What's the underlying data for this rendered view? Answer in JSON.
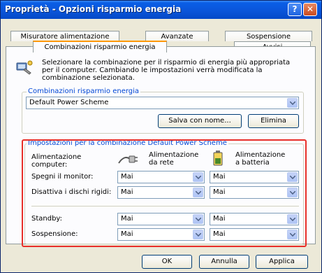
{
  "window": {
    "title": "Proprietà - Opzioni risparmio energia",
    "help_button": "?",
    "close_button": "✕"
  },
  "tabs": {
    "row1": [
      "Misuratore alimentazione",
      "Avanzate",
      "Sospensione"
    ],
    "row2": [
      "Combinazioni risparmio energia",
      "Avvisi"
    ],
    "active": "Combinazioni risparmio energia"
  },
  "intro": {
    "text": "Selezionare la combinazione per il risparmio di energia più appropriata per il computer. Cambiando le impostazioni verrà modificata la combinazione selezionata."
  },
  "schemes": {
    "group_title": "Combinazioni risparmio energia",
    "selected": "Default Power Scheme",
    "save_as": "Salva con nome...",
    "delete": "Elimina"
  },
  "settings": {
    "group_title": "Impostazioni per la combinazione Default Power Scheme",
    "computer_power_label": "Alimentazione computer:",
    "ac_label": "Alimentazione da rete",
    "battery_label": "Alimentazione a batteria",
    "rows": [
      {
        "label": "Spegni il monitor:",
        "ac": "Mai",
        "dc": "Mai"
      },
      {
        "label": "Disattiva i dischi rigidi:",
        "ac": "Mai",
        "dc": "Mai"
      },
      {
        "label": "Standby:",
        "ac": "Mai",
        "dc": "Mai"
      },
      {
        "label": "Sospensione:",
        "ac": "Mai",
        "dc": "Mai"
      }
    ]
  },
  "footer": {
    "ok": "OK",
    "cancel": "Annulla",
    "apply": "Applica"
  },
  "colors": {
    "title_bar": "#0a54d8",
    "group_title": "#0046d5",
    "highlight": "#e8302a",
    "active_tab": "#ff9900"
  }
}
